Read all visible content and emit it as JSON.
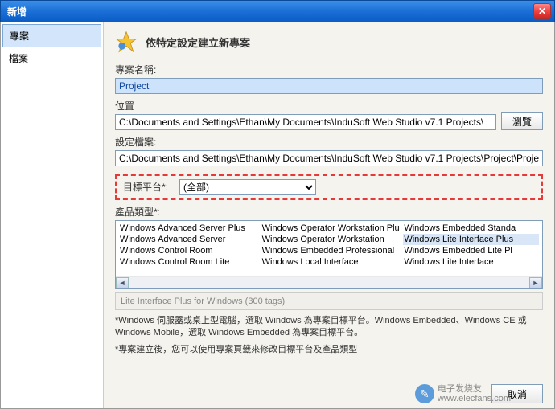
{
  "titlebar": {
    "title": "新增"
  },
  "sidebar": {
    "items": [
      {
        "label": "專案"
      },
      {
        "label": "檔案"
      }
    ]
  },
  "header": {
    "title": "依特定設定建立新專案"
  },
  "form": {
    "name_label": "專案名稱:",
    "name_value": "Project",
    "location_label": "位置",
    "location_value": "C:\\Documents and Settings\\Ethan\\My Documents\\InduSoft Web Studio v7.1 Projects\\",
    "browse_label": "瀏覽",
    "config_label": "設定檔案:",
    "config_value": "C:\\Documents and Settings\\Ethan\\My Documents\\InduSoft Web Studio v7.1 Projects\\Project\\Project.APP",
    "platform_label": "目標平台*:",
    "platform_value": "(全部)",
    "product_label": "產品類型*:"
  },
  "products": {
    "col1": [
      "Windows Advanced Server Plus",
      "Windows Advanced Server",
      "Windows Control Room",
      "Windows Control Room Lite"
    ],
    "col2": [
      "Windows Operator Workstation Plus",
      "Windows Operator Workstation",
      "Windows Embedded Professional",
      "Windows Local Interface"
    ],
    "col3": [
      "Windows Embedded Standa",
      "Windows Lite Interface Plus",
      "Windows Embedded Lite Pl",
      "Windows Lite Interface"
    ]
  },
  "description": "Lite Interface Plus for Windows (300 tags)",
  "note1": "*Windows 伺服器或桌上型電腦，選取 Windows 為專案目標平台。Windows Embedded、Windows CE 或 Windows Mobile，選取 Windows Embedded 為專案目標平台。",
  "note2": "*專案建立後，您可以使用專案頁籤來修改目標平台及產品類型",
  "footer": {
    "cancel": "取消"
  },
  "watermark": {
    "text1": "电子发烧友",
    "text2": "www.elecfans.com"
  }
}
